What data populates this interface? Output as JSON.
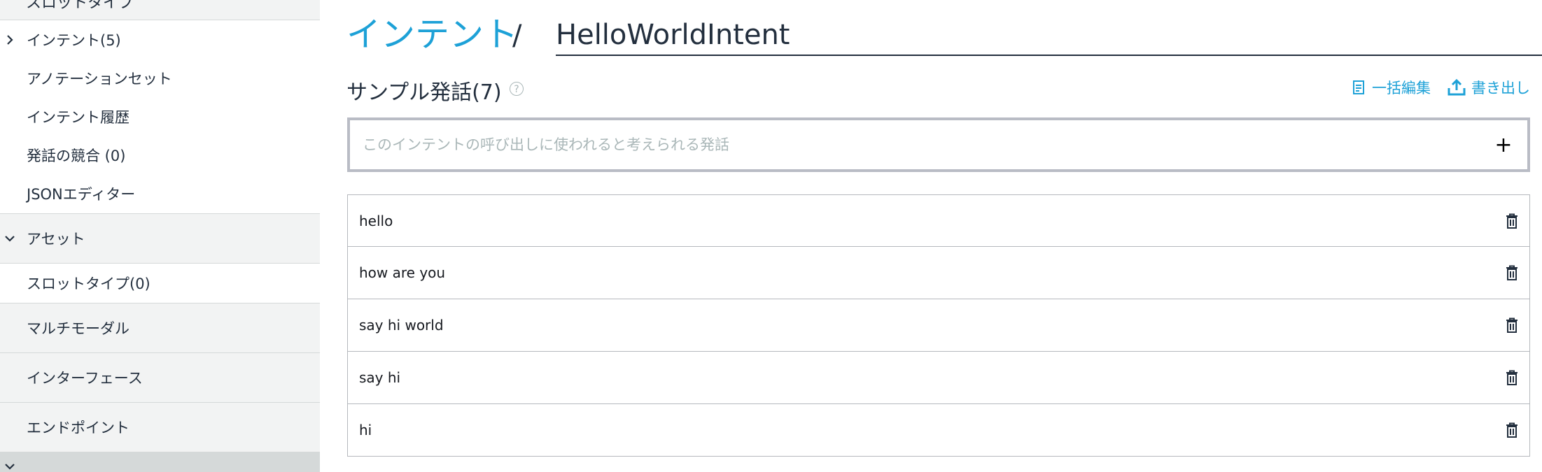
{
  "sidebar": {
    "cut_top_label": "スロットタイプ",
    "items": [
      {
        "label": "インテント(5)",
        "chevron": "chevron-right"
      },
      {
        "label": "アノテーションセット"
      },
      {
        "label": "インテント履歴"
      },
      {
        "label": "発話の競合 (0)"
      },
      {
        "label": "JSONエディター"
      },
      {
        "label": "アセット",
        "chevron": "chevron-down"
      },
      {
        "label": "スロットタイプ(0)"
      },
      {
        "label": "マルチモーダル"
      },
      {
        "label": "インターフェース"
      },
      {
        "label": "エンドポイント"
      }
    ]
  },
  "header": {
    "intent_link": "インテント",
    "separator": "/",
    "intent_name": "HelloWorldIntent"
  },
  "samples": {
    "title": "サンプル発話(7)",
    "help": "?",
    "bulk_edit_label": "一括編集",
    "export_label": "書き出し",
    "input_placeholder": "このインテントの呼び出しに使われると考えられる発話",
    "input_value": "",
    "add_symbol": "+",
    "utterances": [
      "hello",
      "how are you",
      "say hi world",
      "say hi",
      "hi"
    ]
  },
  "colors": {
    "accent": "#1da1d7",
    "text": "#232f3e",
    "sidebar_section_bg": "#f2f3f3"
  }
}
